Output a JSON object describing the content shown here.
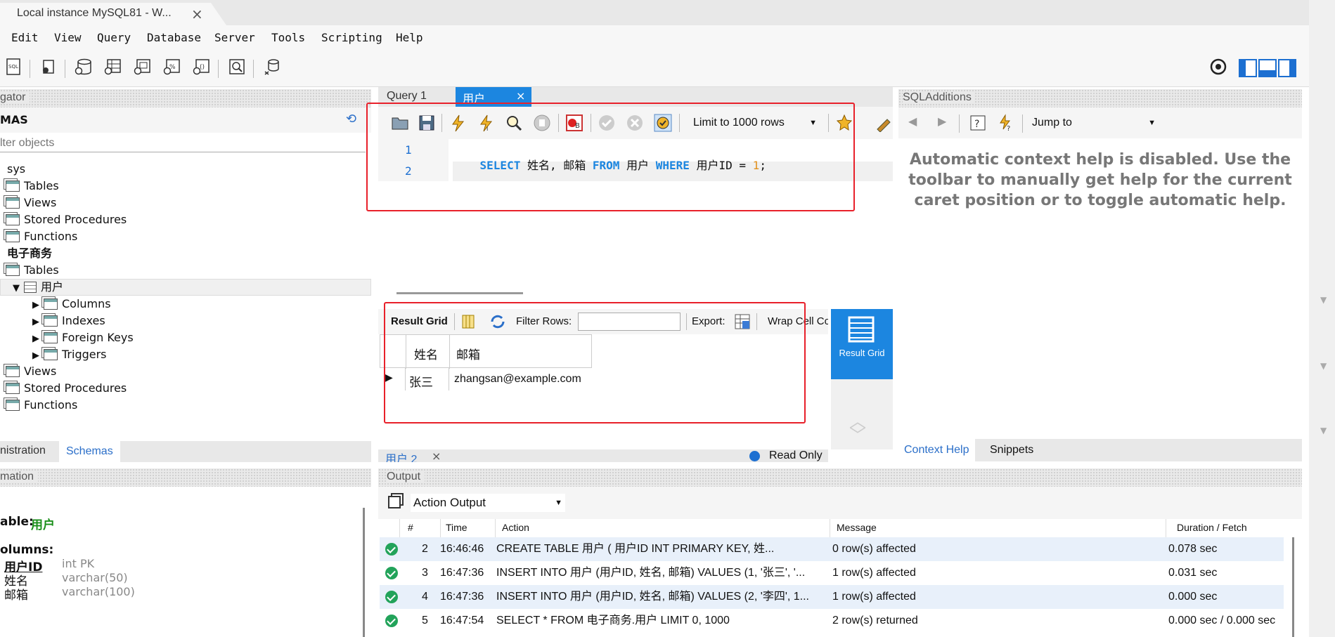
{
  "window": {
    "tab_title": "Local instance MySQL81 - W...",
    "close_symbol": "×"
  },
  "menu": [
    "Edit",
    "View",
    "Query",
    "Database",
    "Server",
    "Tools",
    "Scripting",
    "Help"
  ],
  "navigator": {
    "header": "gator",
    "section_title": "MAS",
    "filter_placeholder": "lter objects",
    "tree": [
      {
        "label": "sys",
        "indent": 0,
        "bold": false
      },
      {
        "label": "Tables",
        "indent": 1
      },
      {
        "label": "Views",
        "indent": 1
      },
      {
        "label": "Stored Procedures",
        "indent": 1
      },
      {
        "label": "Functions",
        "indent": 1
      },
      {
        "label": "电子商务",
        "indent": 0,
        "bold": true
      },
      {
        "label": "Tables",
        "indent": 1
      },
      {
        "label": "用户",
        "indent": 2
      },
      {
        "label": "Columns",
        "indent": 3
      },
      {
        "label": "Indexes",
        "indent": 3
      },
      {
        "label": "Foreign Keys",
        "indent": 3
      },
      {
        "label": "Triggers",
        "indent": 3
      },
      {
        "label": "Views",
        "indent": 1
      },
      {
        "label": "Stored Procedures",
        "indent": 1
      },
      {
        "label": "Functions",
        "indent": 1
      }
    ],
    "bottom_tabs": [
      "nistration",
      "Schemas"
    ]
  },
  "information": {
    "header": "mation",
    "table_label": "able:",
    "table_name": "用户",
    "columns_label": "olumns:",
    "columns": [
      {
        "name": "用户ID",
        "type": "int PK",
        "primary": true
      },
      {
        "name": "姓名",
        "type": "varchar(50)"
      },
      {
        "name": "邮箱",
        "type": "varchar(100)"
      }
    ]
  },
  "editor": {
    "tabs": [
      "Query 1",
      "用户"
    ],
    "limit_select": "Limit to 1000 rows",
    "lines": [
      "1",
      "2"
    ],
    "sql": {
      "kw_select": "SELECT",
      "cols": " 姓名, 邮箱 ",
      "kw_from": "FROM",
      "table": " 用户 ",
      "kw_where": "WHERE",
      "cond": " 用户ID = ",
      "num": "1",
      "semi": ";"
    }
  },
  "result": {
    "toolbar_label": "Result Grid",
    "filter_label": "Filter Rows:",
    "export_label": "Export:",
    "wrap_label": "Wrap Cell Co",
    "side_button": "Result Grid",
    "headers": [
      "姓名",
      "邮箱"
    ],
    "rows": [
      [
        "张三",
        "zhangsan@example.com"
      ]
    ],
    "bottom_tab": "用户 2",
    "read_only": "Read Only"
  },
  "sql_additions": {
    "header": "SQLAdditions",
    "jump_to": "Jump to",
    "help_text": "Automatic context help is disabled. Use the toolbar to manually get help for the current caret position or to toggle automatic help.",
    "tabs": [
      "Context Help",
      "Snippets"
    ]
  },
  "output": {
    "header": "Output",
    "select": "Action Output",
    "columns": [
      "#",
      "Time",
      "Action",
      "Message",
      "Duration / Fetch"
    ],
    "rows": [
      {
        "n": "2",
        "time": "16:46:46",
        "action": "CREATE TABLE 用户 (    用户ID INT PRIMARY KEY,    姓...",
        "message": "0 row(s) affected",
        "duration": "0.078 sec"
      },
      {
        "n": "3",
        "time": "16:47:36",
        "action": "INSERT INTO 用户 (用户ID, 姓名, 邮箱) VALUES (1, '张三', '...",
        "message": "1 row(s) affected",
        "duration": "0.031 sec"
      },
      {
        "n": "4",
        "time": "16:47:36",
        "action": "INSERT INTO 用户 (用户ID, 姓名, 邮箱) VALUES (2, '李四', 1...",
        "message": "1 row(s) affected",
        "duration": "0.000 sec"
      },
      {
        "n": "5",
        "time": "16:47:54",
        "action": "SELECT * FROM 电子商务.用户 LIMIT 0, 1000",
        "message": "2 row(s) returned",
        "duration": "0.000 sec / 0.000 sec"
      }
    ]
  }
}
